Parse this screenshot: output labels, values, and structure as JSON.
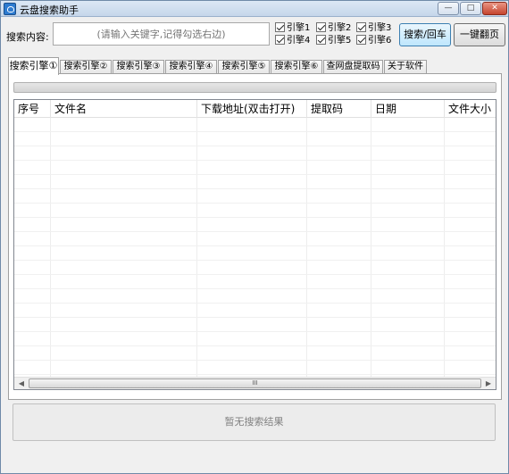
{
  "window": {
    "title": "云盘搜索助手",
    "controls": {
      "minimize": "—",
      "maximize": "□",
      "close": "✕"
    }
  },
  "search": {
    "label": "搜索内容:",
    "placeholder": "(请输入关键字,记得勾选右边)"
  },
  "engines": [
    {
      "label": "引擎1",
      "checked": true
    },
    {
      "label": "引擎2",
      "checked": true
    },
    {
      "label": "引擎3",
      "checked": true
    },
    {
      "label": "引擎4",
      "checked": true
    },
    {
      "label": "引擎5",
      "checked": true
    },
    {
      "label": "引擎6",
      "checked": true
    }
  ],
  "buttons": {
    "search": "搜索/回车",
    "next_page": "一键翻页"
  },
  "tabs": [
    {
      "label": "搜索引擎①",
      "active": true
    },
    {
      "label": "搜索引擎②",
      "active": false
    },
    {
      "label": "搜索引擎③",
      "active": false
    },
    {
      "label": "搜索引擎④",
      "active": false
    },
    {
      "label": "搜索引擎⑤",
      "active": false
    },
    {
      "label": "搜索引擎⑥",
      "active": false
    },
    {
      "label": "查网盘提取码",
      "active": false
    },
    {
      "label": "关于软件",
      "active": false
    }
  ],
  "progress": {
    "value": 0
  },
  "table": {
    "columns": [
      "序号",
      "文件名",
      "下载地址(双击打开)",
      "提取码",
      "日期",
      "文件大小"
    ],
    "rows": []
  },
  "scrollbar": {
    "thumb_grip": "III"
  },
  "status": {
    "text": "暂无搜索结果"
  }
}
